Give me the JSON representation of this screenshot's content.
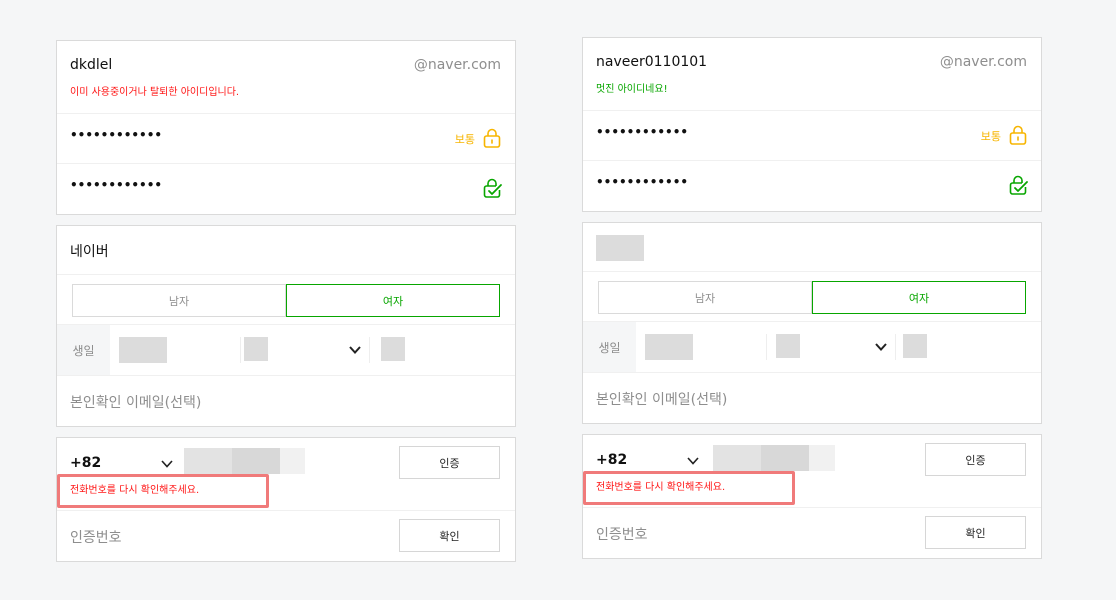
{
  "forms": [
    {
      "id_value": "dkdlel",
      "domain": "@naver.com",
      "id_message": "이미 사용중이거나 탈퇴한 아이디입니다.",
      "password_mask": "••••••••••••",
      "password_level": "보통",
      "password_confirm_mask": "••••••••••••",
      "name_value": "네이버",
      "gender_options": [
        "남자",
        "여자"
      ],
      "gender_selected": "여자",
      "birth_label": "생일",
      "email_placeholder": "본인확인 이메일(선택)",
      "country_code": "+82",
      "auth_button": "인증",
      "phone_message": "전화번호를 다시 확인해주세요.",
      "code_placeholder": "인증번호",
      "confirm_button": "확인"
    },
    {
      "id_value": "naveer0110101",
      "domain": "@naver.com",
      "id_message": "멋진 아이디네요!",
      "password_mask": "••••••••••••",
      "password_level": "보통",
      "password_confirm_mask": "••••••••••••",
      "name_value": "",
      "gender_options": [
        "남자",
        "여자"
      ],
      "gender_selected": "여자",
      "birth_label": "생일",
      "email_placeholder": "본인확인 이메일(선택)",
      "country_code": "+82",
      "auth_button": "인증",
      "phone_message": "전화번호를 다시 확인해주세요.",
      "code_placeholder": "인증번호",
      "confirm_button": "확인"
    }
  ],
  "colors": {
    "error": "#ff1616",
    "success": "#08a600",
    "warning": "#f7b500",
    "highlight": "#f07a7a"
  },
  "icons": {
    "password_level": "lock-icon",
    "password_confirm": "lock-check-icon",
    "dropdown": "chevron-down-icon"
  }
}
